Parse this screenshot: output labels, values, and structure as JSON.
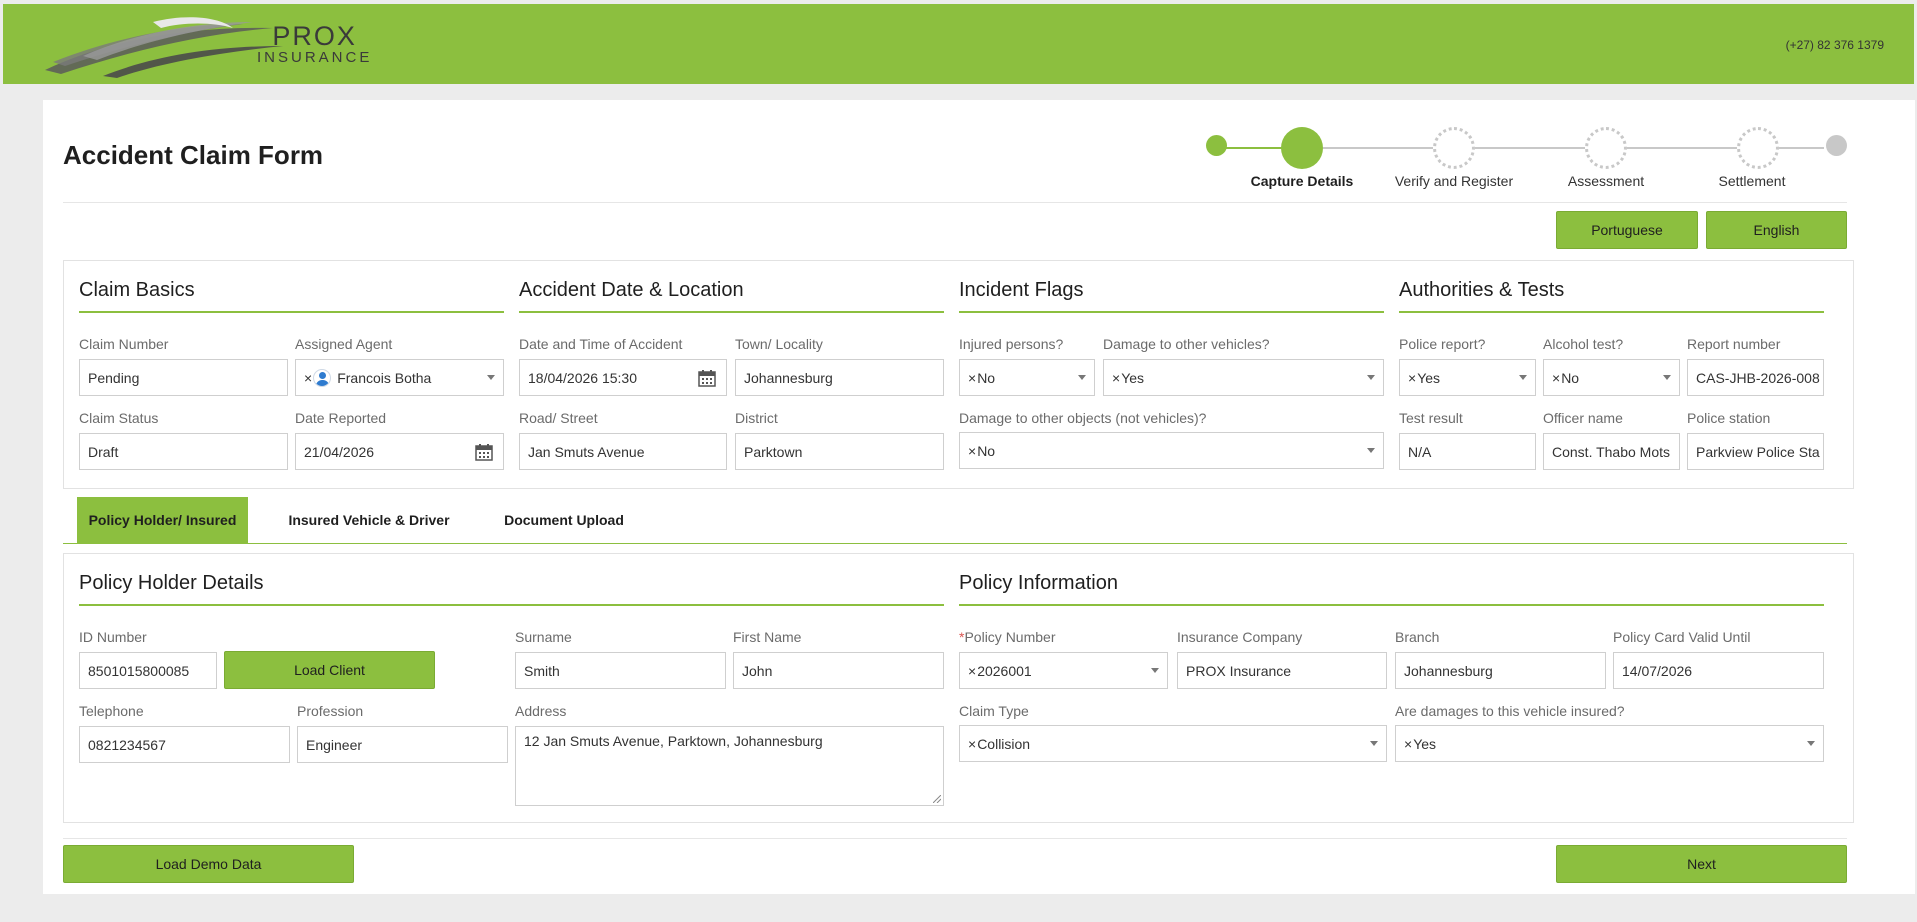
{
  "header": {
    "brand_line1": "PROX",
    "brand_line2": "INSURANCE",
    "phone": "(+27) 82 376 1379",
    "brand_color": "#8cbf3f"
  },
  "form": {
    "title": "Accident Claim Form"
  },
  "stepper": {
    "steps": [
      {
        "label": "Capture Details",
        "state": "active"
      },
      {
        "label": "Verify and Register",
        "state": "pending"
      },
      {
        "label": "Assessment",
        "state": "pending"
      },
      {
        "label": "Settlement",
        "state": "pending"
      }
    ]
  },
  "language": {
    "portuguese": "Portuguese",
    "english": "English"
  },
  "claim_basics": {
    "title": "Claim Basics",
    "claim_number_label": "Claim Number",
    "claim_number": "Pending",
    "assigned_agent_label": "Assigned Agent",
    "assigned_agent": "Francois Botha",
    "claim_status_label": "Claim Status",
    "claim_status": "Draft",
    "date_reported_label": "Date Reported",
    "date_reported": "21/04/2026"
  },
  "accident": {
    "title": "Accident Date & Location",
    "datetime_label": "Date and Time of Accident",
    "datetime": "18/04/2026 15:30",
    "town_label": "Town/ Locality",
    "town": "Johannesburg",
    "road_label": "Road/ Street",
    "road": "Jan Smuts Avenue",
    "district_label": "District",
    "district": "Parktown"
  },
  "incident": {
    "title": "Incident Flags",
    "injured_label": "Injured persons?",
    "injured": "No",
    "damage_vehicles_label": "Damage to other vehicles?",
    "damage_vehicles": "Yes",
    "damage_objects_label": "Damage to other objects (not vehicles)?",
    "damage_objects": "No"
  },
  "authorities": {
    "title": "Authorities & Tests",
    "police_report_label": "Police report?",
    "police_report": "Yes",
    "alcohol_test_label": "Alcohol test?",
    "alcohol_test": "No",
    "report_number_label": "Report number",
    "report_number": "CAS-JHB-2026-008",
    "test_result_label": "Test result",
    "test_result": "N/A",
    "officer_label": "Officer name",
    "officer": "Const. Thabo Mots",
    "station_label": "Police station",
    "station": "Parkview Police Sta"
  },
  "tabs": [
    {
      "label": "Policy Holder/ Insured",
      "active": true
    },
    {
      "label": "Insured Vehicle & Driver",
      "active": false
    },
    {
      "label": "Document Upload",
      "active": false
    }
  ],
  "policy_holder": {
    "title": "Policy Holder Details",
    "id_label": "ID Number",
    "id_number": "8501015800085",
    "load_client": "Load Client",
    "surname_label": "Surname",
    "surname": "Smith",
    "first_name_label": "First Name",
    "first_name": "John",
    "telephone_label": "Telephone",
    "telephone": "0821234567",
    "profession_label": "Profession",
    "profession": "Engineer",
    "address_label": "Address",
    "address": "12 Jan Smuts Avenue, Parktown, Johannesburg"
  },
  "policy_info": {
    "title": "Policy Information",
    "required_mark": "*",
    "policy_number_label": "Policy Number",
    "policy_number": "2026001",
    "company_label": "Insurance Company",
    "company": "PROX Insurance",
    "branch_label": "Branch",
    "branch": "Johannesburg",
    "valid_until_label": "Policy Card Valid Until",
    "valid_until": "14/07/2026",
    "claim_type_label": "Claim Type",
    "claim_type": "Collision",
    "damages_insured_label": "Are damages to this vehicle insured?",
    "damages_insured": "Yes"
  },
  "footer": {
    "load_demo": "Load Demo Data",
    "next": "Next"
  }
}
